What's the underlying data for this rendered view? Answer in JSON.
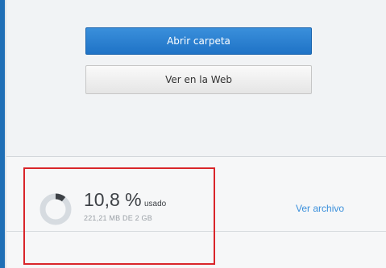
{
  "actions": {
    "open_folder_label": "Abrir carpeta",
    "view_web_label": "Ver en la Web"
  },
  "storage": {
    "percent_value": "10,8",
    "percent_sign": " %",
    "used_label": "usado",
    "detail": "221,21 MB DE 2 GB",
    "used_fraction": 0.108,
    "view_files_label": "Ver archivo"
  },
  "colors": {
    "accent": "#1f73c6",
    "highlight": "#d9252a",
    "donut_track": "#d6dbe0",
    "donut_fill": "#3d4146"
  }
}
